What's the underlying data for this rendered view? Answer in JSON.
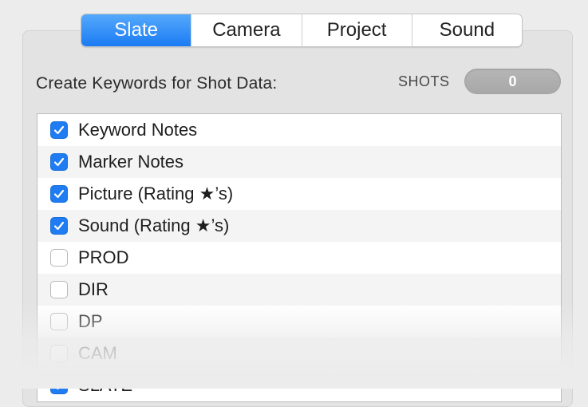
{
  "tabs": [
    {
      "label": "Slate",
      "active": true
    },
    {
      "label": "Camera",
      "active": false
    },
    {
      "label": "Project",
      "active": false
    },
    {
      "label": "Sound",
      "active": false
    }
  ],
  "section": {
    "heading": "Create Keywords for Shot Data:",
    "shots_label": "SHOTS",
    "shots_value": "0"
  },
  "keywords": [
    {
      "label": "Keyword Notes",
      "checked": true
    },
    {
      "label": "Marker Notes",
      "checked": true
    },
    {
      "label": "Picture (Rating ★’s)",
      "checked": true
    },
    {
      "label": "Sound (Rating ★’s)",
      "checked": true
    },
    {
      "label": "PROD",
      "checked": false
    },
    {
      "label": "DIR",
      "checked": false
    },
    {
      "label": "DP",
      "checked": false
    },
    {
      "label": "CAM",
      "checked": false
    },
    {
      "label": "SLATE",
      "checked": true
    }
  ],
  "colors": {
    "accent": "#1f7cf2",
    "panel": "#e3e3e3",
    "background": "#ececec"
  }
}
